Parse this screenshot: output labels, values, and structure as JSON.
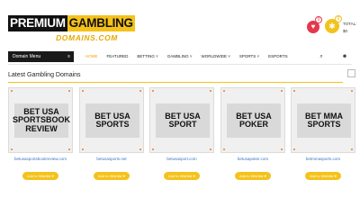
{
  "logo": {
    "part1": "PREMIUM",
    "part2": "GAMBLING",
    "sub": "DOMAINS.COM"
  },
  "header": {
    "wishlist_count": "0",
    "cart_count": "0",
    "total_label": "TOTAL:",
    "total_value": "$0"
  },
  "nav": {
    "domain_menu": "Domain Menu",
    "items": [
      "HOME",
      "FEATURED",
      "BETTING ˅",
      "GAMBLING ˅",
      "WORLDWIDE ˅",
      "SPORTS ˅",
      "ESPORTS"
    ]
  },
  "section": {
    "title": "Latest Gambling Domains"
  },
  "cards": [
    {
      "plate": "BET USA SPORTSBOOK REVIEW",
      "domain": "betusasportsbookreview.com",
      "button": "Add to Wishlist ♥"
    },
    {
      "plate": "BET USA SPORTS",
      "domain": "betusasports.net",
      "button": "Add to Wishlist ♥"
    },
    {
      "plate": "BET USA SPORT",
      "domain": "betusasport.com",
      "button": "Add to Wishlist ♥"
    },
    {
      "plate": "BET USA POKER",
      "domain": "betusapoker.com",
      "button": "Add to Wishlist ♥"
    },
    {
      "plate": "BET MMA SPORTS",
      "domain": "betmmasports.com",
      "button": "Add to Wishlist ♥"
    }
  ],
  "colors": {
    "accent": "#f5c21b",
    "link": "#3b74c0",
    "heart": "#e5384c"
  },
  "icons": {
    "wishlist": "heart-icon",
    "cart": "cart-icon",
    "search": "search-icon",
    "user": "user-icon"
  }
}
